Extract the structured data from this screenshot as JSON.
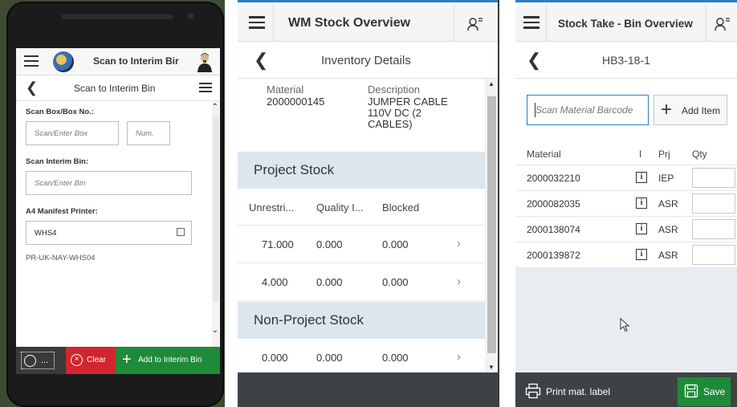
{
  "colors": {
    "accent_blue": "#2a7fc0",
    "clear_red": "#d1262d",
    "action_green": "#1f8a3a",
    "section_bg": "#dbe6ee",
    "footer_dark": "#3f4245"
  },
  "panel1": {
    "header_title": "Scan to Interim Bir",
    "subtitle": "Scan to Interim Bin",
    "fields": {
      "box_label": "Scan Box/Box No.:",
      "box_placeholder": "Scan/Enter Box",
      "num_placeholder": "Num.",
      "bin_label": "Scan Interim Bin:",
      "bin_placeholder": "Scan/Enter Bin",
      "printer_label": "A4 Manifest Printer:",
      "printer_value": "WHS4",
      "printer_id": "PR-UK-NAY-WHS04"
    },
    "footer": {
      "more_label": "...",
      "clear_label": "Clear",
      "add_label": "Add to Interim Bin"
    }
  },
  "panel2": {
    "app_title": "WM Stock Overview",
    "subtitle": "Inventory Details",
    "material_label": "Material",
    "material_value": "2000000145",
    "description_label": "Description",
    "description_lines": [
      "JUMPER CABLE",
      "110V DC (2",
      "CABLES)"
    ],
    "project_stock_title": "Project Stock",
    "columns": [
      "Unrestri...",
      "Quality I...",
      "Blocked"
    ],
    "project_rows": [
      [
        "71.000",
        "0.000",
        "0.000"
      ],
      [
        "4.000",
        "0.000",
        "0.000"
      ]
    ],
    "non_project_title": "Non-Project Stock",
    "non_project_rows": [
      [
        "0.000",
        "0.000",
        "0.000"
      ]
    ]
  },
  "panel3": {
    "app_title": "Stock Take - Bin Overview",
    "subtitle": "HB3-18-1",
    "scan_placeholder": "Scan Material Barcode",
    "add_item_label": "Add Item",
    "columns": [
      "Material",
      "I",
      "Prj",
      "Qty"
    ],
    "rows": [
      {
        "material": "2000032210",
        "prj": "IEP"
      },
      {
        "material": "2000082035",
        "prj": "ASR"
      },
      {
        "material": "2000138074",
        "prj": "ASR"
      },
      {
        "material": "2000139872",
        "prj": "ASR"
      }
    ],
    "print_label": "Print mat. label",
    "save_label": "Save"
  },
  "icons": {
    "info": "i",
    "back": "❮",
    "chevron": "›"
  }
}
